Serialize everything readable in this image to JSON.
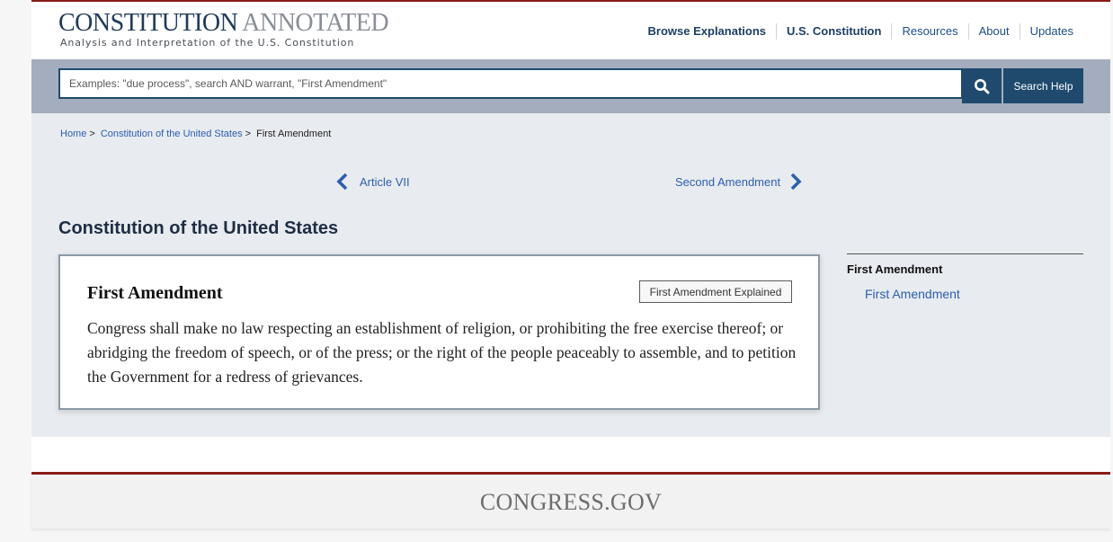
{
  "header": {
    "logo_main_bold": "CONSTITUTION",
    "logo_main_thin": " ANNOTATED",
    "logo_sub": "Analysis and Interpretation of the U.S. Constitution",
    "nav": [
      "Browse Explanations",
      "U.S. Constitution",
      "Resources",
      "About",
      "Updates"
    ]
  },
  "search": {
    "placeholder": "Examples: \"due process\", search AND warrant, \"First Amendment\"",
    "search_icon": "search-icon",
    "help_label": "Search Help"
  },
  "breadcrumb": {
    "home": "Home",
    "constitution": "Constitution of the United States",
    "current": "First Amendment",
    "separator": ">"
  },
  "pager": {
    "prev_label": "Article VII",
    "next_label": "Second Amendment"
  },
  "main": {
    "page_title": "Constitution of the United States",
    "card_title": "First Amendment",
    "explained_button": "First Amendment Explained",
    "text": "Congress shall make no law respecting an establishment of religion, or prohibiting the free exercise thereof; or abridging the freedom of speech, or of the press; or the right of the people peaceably to assemble, and to petition the Government for a redress of grievances."
  },
  "sidebar": {
    "heading": "First Amendment",
    "link": "First Amendment"
  },
  "footer": {
    "logo": "CONGRESS.GOV"
  },
  "colors": {
    "brand_navy": "#1f4a6e",
    "accent_red": "#8b1a1a",
    "link_blue": "#2c5fae"
  }
}
